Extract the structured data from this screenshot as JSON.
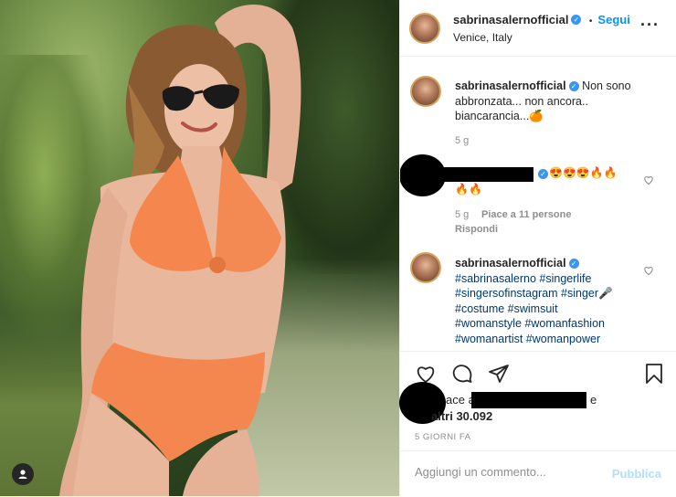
{
  "header": {
    "username": "sabrinasalernofficial",
    "follow_label": "Segui",
    "separator": "•",
    "location": "Venice, Italy",
    "more_icon": "more-options-icon"
  },
  "caption": {
    "username": "sabrinasalernofficial",
    "text_line1": "Non sono",
    "text_line2": "abbronzata... non ancora..",
    "text_line3": "biancarancia...🍊",
    "time": "5 g"
  },
  "comment1": {
    "emojis_line1": "😍😍😍🔥🔥",
    "emojis_line2": "🔥🔥",
    "time": "5 g",
    "likes": "Piace a 11 persone",
    "reply": "Rispondi"
  },
  "comment2": {
    "username": "sabrinasalernofficial",
    "lines": [
      "#sabrinasalerno #singerlife",
      "#singersofinstagram #singer🎤",
      "#costume #swimsuit",
      "#womanstyle #womanfashion",
      "#womanartist #womanpower"
    ]
  },
  "likes": {
    "prefix": "ace a",
    "suffix": "e",
    "others": "altri 30.092"
  },
  "post_time": "5 GIORNI FA",
  "add_comment": {
    "placeholder": "Aggiungi un commento...",
    "publish": "Pubblica"
  },
  "colors": {
    "link_blue": "#0095f6",
    "verified_blue": "#3897f0",
    "publish_disabled": "#b2dffc",
    "meta_gray": "#8e8e8e"
  }
}
